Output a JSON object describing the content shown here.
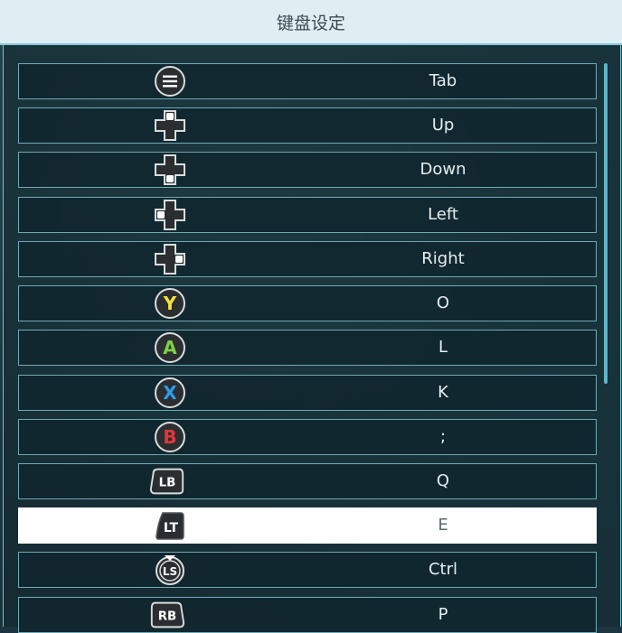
{
  "title": "键盘设定",
  "rows": [
    {
      "icon": "menu-button-icon",
      "key": "Tab",
      "selected": false
    },
    {
      "icon": "dpad-up-icon",
      "key": "Up",
      "selected": false
    },
    {
      "icon": "dpad-down-icon",
      "key": "Down",
      "selected": false
    },
    {
      "icon": "dpad-left-icon",
      "key": "Left",
      "selected": false
    },
    {
      "icon": "dpad-right-icon",
      "key": "Right",
      "selected": false
    },
    {
      "icon": "y-button-icon",
      "key": "O",
      "selected": false,
      "glyph": "Y",
      "color": "#f2e23a"
    },
    {
      "icon": "a-button-icon",
      "key": "L",
      "selected": false,
      "glyph": "A",
      "color": "#7ed04a"
    },
    {
      "icon": "x-button-icon",
      "key": "K",
      "selected": false,
      "glyph": "X",
      "color": "#2f9be6"
    },
    {
      "icon": "b-button-icon",
      "key": ";",
      "selected": false,
      "glyph": "B",
      "color": "#e2363a"
    },
    {
      "icon": "lb-bumper-icon",
      "key": "Q",
      "selected": false,
      "glyph": "LB"
    },
    {
      "icon": "lt-trigger-icon",
      "key": "E",
      "selected": true,
      "glyph": "LT"
    },
    {
      "icon": "ls-stick-icon",
      "key": "Ctrl",
      "selected": false,
      "glyph": "LS"
    },
    {
      "icon": "rb-bumper-icon",
      "key": "P",
      "selected": false,
      "glyph": "RB"
    }
  ]
}
